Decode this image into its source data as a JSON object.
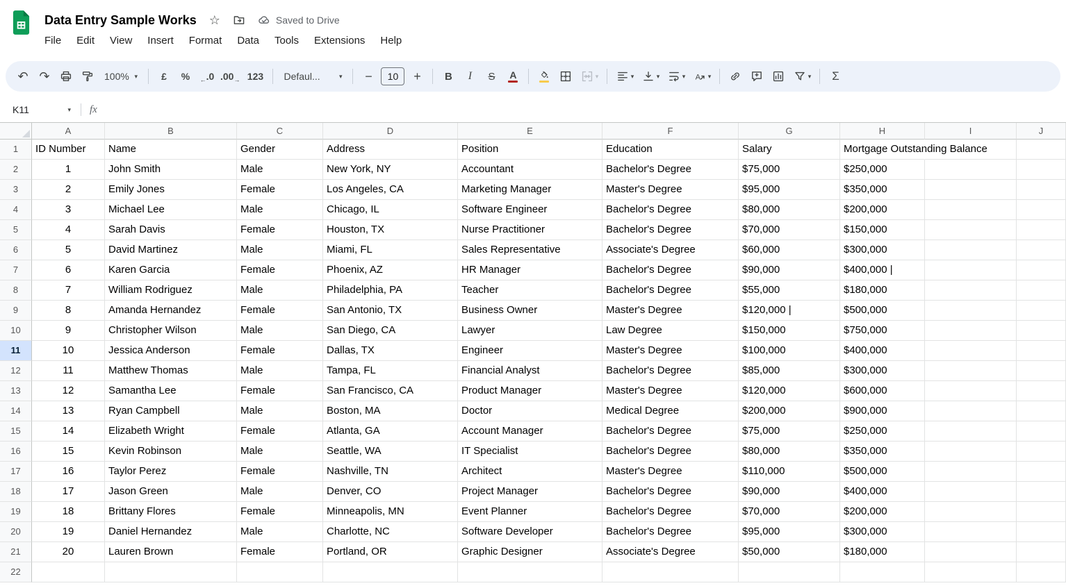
{
  "colors": {
    "brand-green": "#0f9d58",
    "brand-green-dark": "#0a7a43",
    "toolbar-bg": "#edf2fa",
    "selection-blue": "#d3e3fd",
    "grid-line": "#e2e3e3",
    "header-bg": "#f8f9fa",
    "header-border": "#c4c7c5",
    "icon-gray": "#444746",
    "muted-text": "#5f6368",
    "disabled-icon": "#b9bec6",
    "text-color-indicator": "#b3261e",
    "fill-color-indicator": "#f7cb4d"
  },
  "icons": {
    "star": "☆",
    "dropdown": "▾",
    "undo": "↶",
    "redo": "↷",
    "minus": "−",
    "plus": "+",
    "decrease_decimal_arrow": "←",
    "increase_decimal_arrow": "→"
  },
  "header": {
    "doc_title": "Data Entry Sample Works",
    "saved_status": "Saved to Drive",
    "menus": [
      "File",
      "Edit",
      "View",
      "Insert",
      "Format",
      "Data",
      "Tools",
      "Extensions",
      "Help"
    ]
  },
  "toolbar": {
    "zoom_value": "100%",
    "currency_label": "£",
    "percent_label": "%",
    "decrease_decimal_label": ".0",
    "increase_decimal_label": ".00",
    "more_formats_label": "123",
    "font_name": "Defaul...",
    "font_size_value": "10",
    "bold_label": "B",
    "italic_label": "I",
    "strikethrough_label": "S",
    "text_color_label": "A",
    "functions_label": "Σ"
  },
  "formula_bar": {
    "name_box_value": "K11",
    "fx_label": "fx",
    "formula_value": ""
  },
  "grid": {
    "column_letters": [
      "A",
      "B",
      "C",
      "D",
      "E",
      "F",
      "G",
      "H",
      "I",
      "J"
    ],
    "row_count": 22,
    "selected_row": 11,
    "selected_cell": "K11",
    "header_row": [
      "ID Number",
      "Name",
      "Gender",
      "Address",
      "Position",
      "Education",
      "Salary",
      "Mortgage Outstanding Balance"
    ],
    "rows": [
      [
        "1",
        "John Smith",
        "Male",
        "New York, NY",
        "Accountant",
        "Bachelor's Degree",
        "$75,000",
        "$250,000"
      ],
      [
        "2",
        "Emily Jones",
        "Female",
        "Los Angeles, CA",
        "Marketing Manager",
        "Master's Degree",
        "$95,000",
        "$350,000"
      ],
      [
        "3",
        "Michael Lee",
        "Male",
        "Chicago, IL",
        "Software Engineer",
        "Bachelor's Degree",
        "$80,000",
        "$200,000"
      ],
      [
        "4",
        "Sarah Davis",
        "Female",
        "Houston, TX",
        "Nurse Practitioner",
        "Bachelor's Degree",
        "$70,000",
        "$150,000"
      ],
      [
        "5",
        "David Martinez",
        "Male",
        "Miami, FL",
        "Sales Representative",
        "Associate's Degree",
        "$60,000",
        "$300,000"
      ],
      [
        "6",
        "Karen Garcia",
        "Female",
        "Phoenix, AZ",
        "HR Manager",
        "Bachelor's Degree",
        "$90,000",
        "$400,000 |"
      ],
      [
        "7",
        "William Rodriguez",
        "Male",
        "Philadelphia, PA",
        "Teacher",
        "Bachelor's Degree",
        "$55,000",
        "$180,000"
      ],
      [
        "8",
        "Amanda Hernandez",
        "Female",
        "San Antonio, TX",
        "Business Owner",
        "Master's Degree",
        "$120,000 |",
        "$500,000"
      ],
      [
        "9",
        "Christopher Wilson",
        "Male",
        "San Diego, CA",
        "Lawyer",
        "Law Degree",
        "$150,000",
        "$750,000"
      ],
      [
        "10",
        "Jessica Anderson",
        "Female",
        "Dallas, TX",
        "Engineer",
        "Master's Degree",
        "$100,000",
        "$400,000"
      ],
      [
        "11",
        "Matthew Thomas",
        "Male",
        "Tampa, FL",
        "Financial Analyst",
        "Bachelor's Degree",
        "$85,000",
        "$300,000"
      ],
      [
        "12",
        "Samantha Lee",
        "Female",
        "San Francisco, CA",
        "Product Manager",
        "Master's Degree",
        "$120,000",
        "$600,000"
      ],
      [
        "13",
        "Ryan Campbell",
        "Male",
        "Boston, MA",
        "Doctor",
        "Medical Degree",
        "$200,000",
        "$900,000"
      ],
      [
        "14",
        "Elizabeth Wright",
        "Female",
        "Atlanta, GA",
        "Account Manager",
        "Bachelor's Degree",
        "$75,000",
        "$250,000"
      ],
      [
        "15",
        "Kevin Robinson",
        "Male",
        "Seattle, WA",
        "IT Specialist",
        "Bachelor's Degree",
        "$80,000",
        "$350,000"
      ],
      [
        "16",
        "Taylor Perez",
        "Female",
        "Nashville, TN",
        "Architect",
        "Master's Degree",
        "$110,000",
        "$500,000"
      ],
      [
        "17",
        "Jason Green",
        "Male",
        "Denver, CO",
        "Project Manager",
        "Bachelor's Degree",
        "$90,000",
        "$400,000"
      ],
      [
        "18",
        "Brittany Flores",
        "Female",
        "Minneapolis, MN",
        "Event Planner",
        "Bachelor's Degree",
        "$70,000",
        "$200,000"
      ],
      [
        "19",
        "Daniel Hernandez",
        "Male",
        "Charlotte, NC",
        "Software Developer",
        "Bachelor's Degree",
        "$95,000",
        "$300,000"
      ],
      [
        "20",
        "Lauren Brown",
        "Female",
        "Portland, OR",
        "Graphic Designer",
        "Associate's Degree",
        "$50,000",
        "$180,000"
      ]
    ]
  }
}
